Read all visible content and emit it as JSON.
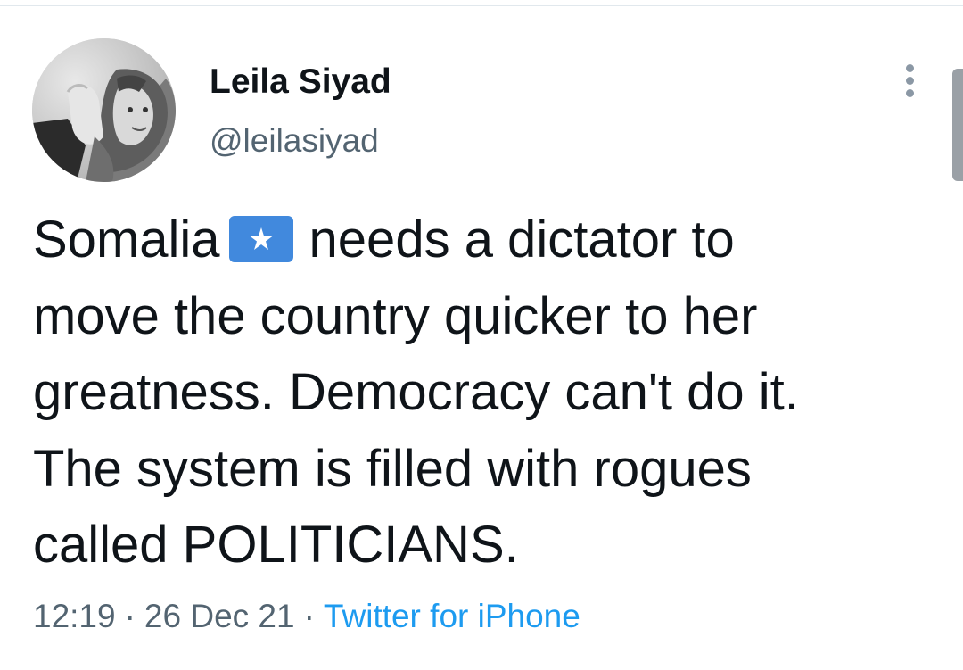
{
  "author": {
    "display_name": "Leila Siyad",
    "handle": "@leilasiyad"
  },
  "tweet": {
    "line_1_before_flag": "Somalia",
    "flag_emoji": "somalia-flag-icon",
    "line_1_after_flag": "needs a dictator to",
    "line_2": "move the country quicker to her",
    "line_3": "greatness. Democracy can't do it.",
    "line_4": "The system is filled with rogues",
    "line_5": "called POLITICIANS."
  },
  "meta": {
    "time": "12:19",
    "separator": "·",
    "date": "26 Dec 21",
    "source": "Twitter for iPhone"
  },
  "icons": {
    "more": "more-vertical-icon",
    "avatar": "profile-avatar"
  },
  "colors": {
    "link": "#1d9bf0",
    "secondary_text": "#536471",
    "flag_blue": "#4189dd"
  }
}
